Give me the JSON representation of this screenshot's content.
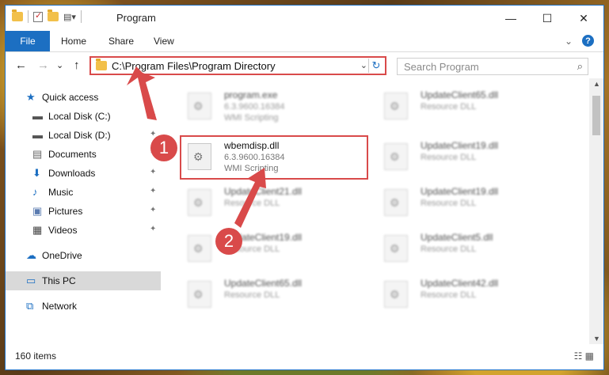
{
  "window": {
    "title": "Program",
    "controls": {
      "minimize": "—",
      "maximize": "☐",
      "close": "✕"
    }
  },
  "ribbon": {
    "file_tab": "File",
    "tabs": [
      "Home",
      "Share",
      "View"
    ],
    "expand": "⌄",
    "help": "?"
  },
  "address": {
    "path": "C:\\Program Files\\Program Directory",
    "dropdown": "⌄",
    "refresh": "↻"
  },
  "search": {
    "placeholder": "Search Program",
    "icon": "⌕"
  },
  "nav": {
    "back": "←",
    "forward": "→",
    "recent": "⌄",
    "up": "↑"
  },
  "sidebar": {
    "items": [
      {
        "label": "Quick access",
        "icon": "star-icon",
        "pinned": false
      },
      {
        "label": "Local Disk (C:)",
        "icon": "drive-icon",
        "pinned": true
      },
      {
        "label": "Local Disk (D:)",
        "icon": "drive-icon",
        "pinned": true
      },
      {
        "label": "Documents",
        "icon": "documents-icon",
        "pinned": true
      },
      {
        "label": "Downloads",
        "icon": "download-icon",
        "pinned": true
      },
      {
        "label": "Music",
        "icon": "music-icon",
        "pinned": true
      },
      {
        "label": "Pictures",
        "icon": "pictures-icon",
        "pinned": true
      },
      {
        "label": "Videos",
        "icon": "videos-icon",
        "pinned": true
      },
      {
        "label": "OneDrive",
        "icon": "cloud-icon",
        "pinned": false
      },
      {
        "label": "This PC",
        "icon": "computer-icon",
        "pinned": false,
        "selected": true
      },
      {
        "label": "Network",
        "icon": "network-icon",
        "pinned": false
      }
    ],
    "pin_glyph": "✦"
  },
  "files": [
    {
      "name": "program.exe",
      "line1": "6.3.9600.16384",
      "line2": "WMI Scripting",
      "blurred": true
    },
    {
      "name": "UpdateClient65.dll",
      "line1": "Resource DLL",
      "line2": "",
      "blurred": true
    },
    {
      "name": "wbemdisp.dll",
      "line1": "6.3.9600.16384",
      "line2": "WMI Scripting",
      "blurred": false
    },
    {
      "name": "UpdateClient19.dll",
      "line1": "Resource DLL",
      "line2": "",
      "blurred": true
    },
    {
      "name": "UpdateClient21.dll",
      "line1": "Resource DLL",
      "line2": "",
      "blurred": true
    },
    {
      "name": "UpdateClient19.dll",
      "line1": "Resource DLL",
      "line2": "",
      "blurred": true
    },
    {
      "name": "UpdateClient19.dll",
      "line1": "Resource DLL",
      "line2": "",
      "blurred": true
    },
    {
      "name": "UpdateClient5.dll",
      "line1": "Resource DLL",
      "line2": "",
      "blurred": true
    },
    {
      "name": "UpdateClient65.dll",
      "line1": "Resource DLL",
      "line2": "",
      "blurred": true
    },
    {
      "name": "UpdateClient42.dll",
      "line1": "Resource DLL",
      "line2": "",
      "blurred": true
    }
  ],
  "markers": [
    "1",
    "2"
  ],
  "status": {
    "items_count": "160 items",
    "view_icons": "☷ ▦"
  },
  "colors": {
    "accent": "#1c6fc2",
    "highlight": "#d94a4a"
  }
}
